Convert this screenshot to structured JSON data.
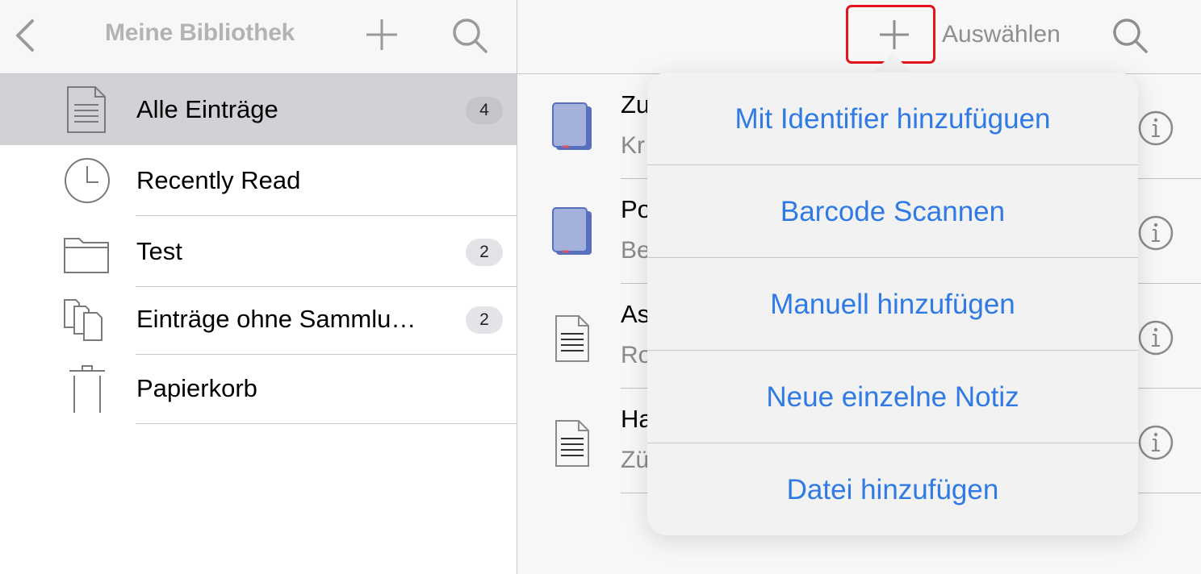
{
  "sidebar": {
    "title": "Meine Bibliothek",
    "items": [
      {
        "label": "Alle Einträge",
        "badge": "4"
      },
      {
        "label": "Recently Read",
        "badge": ""
      },
      {
        "label": "Test",
        "badge": "2"
      },
      {
        "label": "Einträge ohne Sammlu…",
        "badge": "2"
      },
      {
        "label": "Papierkorb",
        "badge": ""
      }
    ]
  },
  "main": {
    "select_label": "Auswählen",
    "items": [
      {
        "title": "Zu",
        "subtitle": "Kr",
        "icon": "book-icon"
      },
      {
        "title": "Po",
        "subtitle": "Be",
        "icon": "book-icon"
      },
      {
        "title": "As",
        "subtitle": "Ro",
        "icon": "document-icon"
      },
      {
        "title": "Ha",
        "subtitle": "Zü",
        "icon": "document-icon"
      }
    ]
  },
  "popover": {
    "items": [
      "Mit Identifier hinzufüguen",
      "Barcode Scannen",
      "Manuell hinzufügen",
      "Neue einzelne Notiz",
      "Datei hinzufügen"
    ]
  },
  "colors": {
    "accent": "#2f7ae5",
    "highlight_border": "#e3141b",
    "selected_row": "#d1d1d6"
  }
}
